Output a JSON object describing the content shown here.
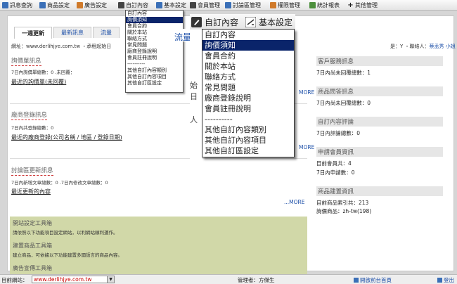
{
  "menubar": [
    {
      "label": "訊息查詢",
      "icon": "search-icon"
    },
    {
      "label": "商品設定",
      "icon": "box-icon"
    },
    {
      "label": "廣告設定",
      "icon": "ad-icon"
    },
    {
      "label": "自訂內容",
      "icon": "pencil-icon"
    },
    {
      "label": "基本設定",
      "icon": "settings-icon"
    },
    {
      "label": "會員管理",
      "icon": "members-icon"
    },
    {
      "label": "討論區管理",
      "icon": "forum-icon"
    },
    {
      "label": "權限管理",
      "icon": "lock-icon"
    },
    {
      "label": "統計報表",
      "icon": "chart-icon"
    },
    {
      "label": "其他管理",
      "icon": "plus-icon"
    }
  ],
  "tabs": [
    "一週更新",
    "最新訊息",
    "流量"
  ],
  "info": {
    "site": "網址：www.derlihjye.com.tw ・承租起始日",
    "status": "是：Y ・聯絡人：",
    "contact": "蔡孟秀 小姐"
  },
  "sections": [
    {
      "title": "詢價單訊息",
      "stat": "7日內詢價單總數：0 .未回覆：",
      "link": "最近的詢價單(未回覆)",
      "more": "MORE"
    },
    {
      "title": "廠商登錄訊息",
      "stat": "7日內共登錄總數：0",
      "link": "最近的廠商登錄(公司名稱 / 地區 / 登錄日期)",
      "more": "MORE"
    },
    {
      "title": "討論區更新訊息",
      "stat": "7日內新增文章總數：0 .7日內修改文章總數：0",
      "link": "最近更新的內容",
      "more": "...MORE"
    }
  ],
  "right_panel": [
    {
      "title": "客戶服務訊息",
      "lines": [
        "7日內尚未回覆總數：1"
      ]
    },
    {
      "title": "商品問答訊息",
      "lines": [
        "7日內尚未回覆總數：0"
      ]
    },
    {
      "title": "自訂內容評論",
      "lines": [
        "7日內評論總數：0"
      ]
    },
    {
      "title": "申請會員資訊",
      "lines": [
        "目前會員共：4",
        "7日內申請數：0"
      ]
    },
    {
      "title": "商品建置資訊",
      "lines": [
        "目前商品索引共：213",
        "詢價商品：zh-tw(198)"
      ]
    }
  ],
  "toolbox": [
    {
      "title": "開站設定工具箱",
      "desc": "請依照以下功能項目設定網站，以利網站順利運作。"
    },
    {
      "title": "建置商品工具箱",
      "desc": "建立商品，可依據以下功能建置多國語言的商品內容。"
    },
    {
      "title": "廣告宣傳工具箱",
      "desc": ""
    }
  ],
  "submenu_small": {
    "header": "自訂內容",
    "items": [
      "詢價須知",
      "會員合約",
      "關於本站",
      "聯絡方式",
      "常見問題",
      "廠商登錄說明",
      "會員註冊說明",
      "----------",
      "其他自訂內容類別",
      "其他自訂內容項目",
      "其他自訂區設定"
    ],
    "highlighted": 0
  },
  "zoom": {
    "header1": "自訂內容",
    "header2": "基本設定",
    "behind_text": "流量",
    "behind_chars": [
      "始日",
      "人"
    ],
    "items": [
      "自訂內容",
      "詢價須知",
      "會員合約",
      "關於本站",
      "聯絡方式",
      "常見問題",
      "廠商登錄說明",
      "會員註冊說明",
      "----------",
      "其他自訂內容類別",
      "其他自訂內容項目",
      "其他自訂區設定"
    ],
    "highlighted": 1
  },
  "statusbar": {
    "site_label": "目前網站：",
    "site_value": "www.derlihjye.com.tw",
    "admin": "管理者：方傑生",
    "front": "開啟前台首頁",
    "logout": "登出"
  }
}
